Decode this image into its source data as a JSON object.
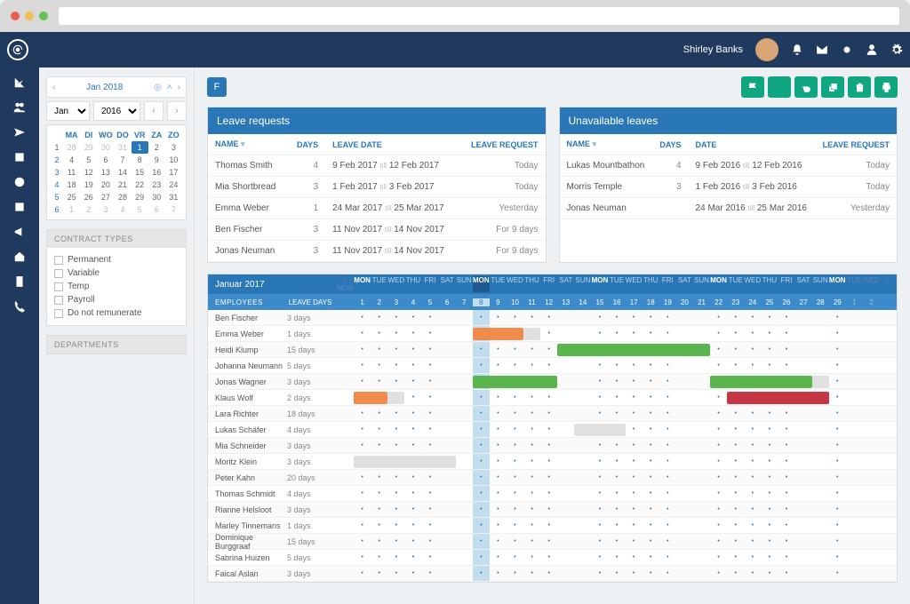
{
  "user_name": "Shirley Banks",
  "filter_label": "F",
  "cal_title": "Jan 2018",
  "cal_month": "Jan",
  "cal_year": "2016",
  "dow": [
    "MA",
    "DI",
    "WO",
    "DO",
    "VR",
    "ZA",
    "ZO"
  ],
  "weeks": [
    {
      "w": "1",
      "d": [
        [
          "28",
          1
        ],
        [
          "29",
          1
        ],
        [
          "30",
          1
        ],
        [
          "31",
          1
        ],
        [
          "1",
          2
        ],
        [
          "2",
          0
        ],
        [
          "3",
          0
        ]
      ]
    },
    {
      "w": "2",
      "d": [
        [
          "4",
          0
        ],
        [
          "5",
          0
        ],
        [
          "6",
          0
        ],
        [
          "7",
          0
        ],
        [
          "8",
          0
        ],
        [
          "9",
          0
        ],
        [
          "10",
          0
        ]
      ]
    },
    {
      "w": "3",
      "d": [
        [
          "11",
          0
        ],
        [
          "12",
          0
        ],
        [
          "13",
          0
        ],
        [
          "14",
          0
        ],
        [
          "15",
          0
        ],
        [
          "16",
          0
        ],
        [
          "17",
          0
        ]
      ]
    },
    {
      "w": "4",
      "d": [
        [
          "18",
          0
        ],
        [
          "19",
          0
        ],
        [
          "20",
          0
        ],
        [
          "21",
          0
        ],
        [
          "22",
          0
        ],
        [
          "23",
          0
        ],
        [
          "24",
          0
        ]
      ]
    },
    {
      "w": "5",
      "d": [
        [
          "25",
          0
        ],
        [
          "26",
          0
        ],
        [
          "27",
          0
        ],
        [
          "28",
          0
        ],
        [
          "29",
          0
        ],
        [
          "30",
          0
        ],
        [
          "31",
          0
        ]
      ]
    },
    {
      "w": "6",
      "d": [
        [
          "1",
          1
        ],
        [
          "2",
          1
        ],
        [
          "3",
          1
        ],
        [
          "4",
          1
        ],
        [
          "5",
          1
        ],
        [
          "6",
          1
        ],
        [
          "7",
          1
        ]
      ]
    }
  ],
  "contract_types_h": "CONTRACT TYPES",
  "contract_types": [
    "Permanent",
    "Variable",
    "Temp",
    "Payroll",
    "Do not remunerate"
  ],
  "departments_h": "DEPARTMENTS",
  "leave_card_h": "Leave requests",
  "cols": {
    "name": "NAME",
    "days": "DAYS",
    "date": "LEAVE DATE",
    "req": "LEAVE REQUEST",
    "date2": "DATE"
  },
  "leave_rows": [
    {
      "n": "Thomas Smith",
      "d": "4",
      "f": "9 Feb 2017",
      "t": "12 Feb 2017",
      "r": "Today"
    },
    {
      "n": "Mia Shortbread",
      "d": "3",
      "f": "1 Feb 2017",
      "t": "3 Feb 2017",
      "r": "Today"
    },
    {
      "n": "Emma Weber",
      "d": "1",
      "f": "24 Mar 2017",
      "t": "25 Mar 2017",
      "r": "Yesterday"
    },
    {
      "n": "Ben Fischer",
      "d": "3",
      "f": "11 Nov 2017",
      "t": "14 Nov 2017",
      "r": "For 9 days"
    },
    {
      "n": "Jonas Neuman",
      "d": "3",
      "f": "11 Nov 2017",
      "t": "14 Nov 2017",
      "r": "For 9 days"
    }
  ],
  "unavail_card_h": "Unavailable leaves",
  "unavail_rows": [
    {
      "n": "Lukas Mountbathon",
      "d": "4",
      "f": "9 Feb 2016",
      "t": "12 Feb 2016",
      "r": "Today"
    },
    {
      "n": "Morris Temple",
      "d": "3",
      "f": "1 Feb 2016",
      "t": "3 Feb 2016",
      "r": "Today"
    },
    {
      "n": "Jonas Neuman",
      "d": "",
      "f": "24 Mar 2016",
      "t": "25 Mar 2016",
      "r": "Yesterday"
    }
  ],
  "sched_month": "Januar 2017",
  "sched_emp_h": "EMPLOYEES",
  "sched_lvd_h": "LEAVE DAYS",
  "sched_dow": [
    "MON",
    "TUE",
    "WED",
    "THU",
    "FRI",
    "SAT",
    "SUN",
    "MON",
    "TUE",
    "WED",
    "THU",
    "FRI",
    "SAT",
    "SUN",
    "MON",
    "TUE",
    "WED",
    "THU",
    "FRI",
    "SAT",
    "SUN",
    "MON",
    "TUE",
    "WED",
    "THU",
    "FRI",
    "SAT",
    "SUN",
    "MON",
    "TUE",
    "WED"
  ],
  "sched_nums": [
    "1",
    "2",
    "3",
    "4",
    "5",
    "6",
    "7",
    "8",
    "9",
    "10",
    "11",
    "12",
    "13",
    "14",
    "15",
    "16",
    "17",
    "18",
    "19",
    "20",
    "21",
    "22",
    "23",
    "24",
    "25",
    "26",
    "27",
    "28",
    "29",
    "1",
    "2"
  ],
  "sched_rows": [
    {
      "n": "Ben Fischer",
      "d": "3 days"
    },
    {
      "n": "Emma Weber",
      "d": "1 days",
      "bars": [
        {
          "c": "o",
          "s": 8,
          "e": 10
        },
        {
          "c": "gy",
          "s": 11,
          "e": 11
        }
      ]
    },
    {
      "n": "Heidi Klump",
      "d": "15 days",
      "bars": [
        {
          "c": "g",
          "s": 13,
          "e": 21
        }
      ]
    },
    {
      "n": "Johanna Neumann",
      "d": "5 days"
    },
    {
      "n": "Jonas Wagner",
      "d": "3 days",
      "bars": [
        {
          "c": "g",
          "s": 8,
          "e": 12
        },
        {
          "c": "g",
          "s": 22,
          "e": 27
        },
        {
          "c": "gy",
          "s": 28,
          "e": 28
        }
      ]
    },
    {
      "n": "Klaus Wolf",
      "d": "2 days",
      "bars": [
        {
          "c": "o",
          "s": 1,
          "e": 2
        },
        {
          "c": "gy",
          "s": 3,
          "e": 3
        },
        {
          "c": "rd",
          "s": 23,
          "e": 28
        }
      ]
    },
    {
      "n": "Lara Richter",
      "d": "18 days"
    },
    {
      "n": "Lukas Schäfer",
      "d": "4 days",
      "bars": [
        {
          "c": "gy",
          "s": 14,
          "e": 16
        }
      ]
    },
    {
      "n": "Mia Schneider",
      "d": "3 days"
    },
    {
      "n": "Moritz Klein",
      "d": "3 days",
      "bars": [
        {
          "c": "gy",
          "s": 1,
          "e": 6
        }
      ]
    },
    {
      "n": "Peter Kahn",
      "d": "20 days"
    },
    {
      "n": "Thomas Schmidt",
      "d": "4 days"
    },
    {
      "n": "Rianne Helsloot",
      "d": "3 days"
    },
    {
      "n": "Marley Tinnemans",
      "d": "1 days"
    },
    {
      "n": "Dominique Burggraaf",
      "d": "15 days"
    },
    {
      "n": "Sabrina Huizen",
      "d": "5 days"
    },
    {
      "n": "Faical Aslan",
      "d": "3 days"
    }
  ],
  "till": "till"
}
